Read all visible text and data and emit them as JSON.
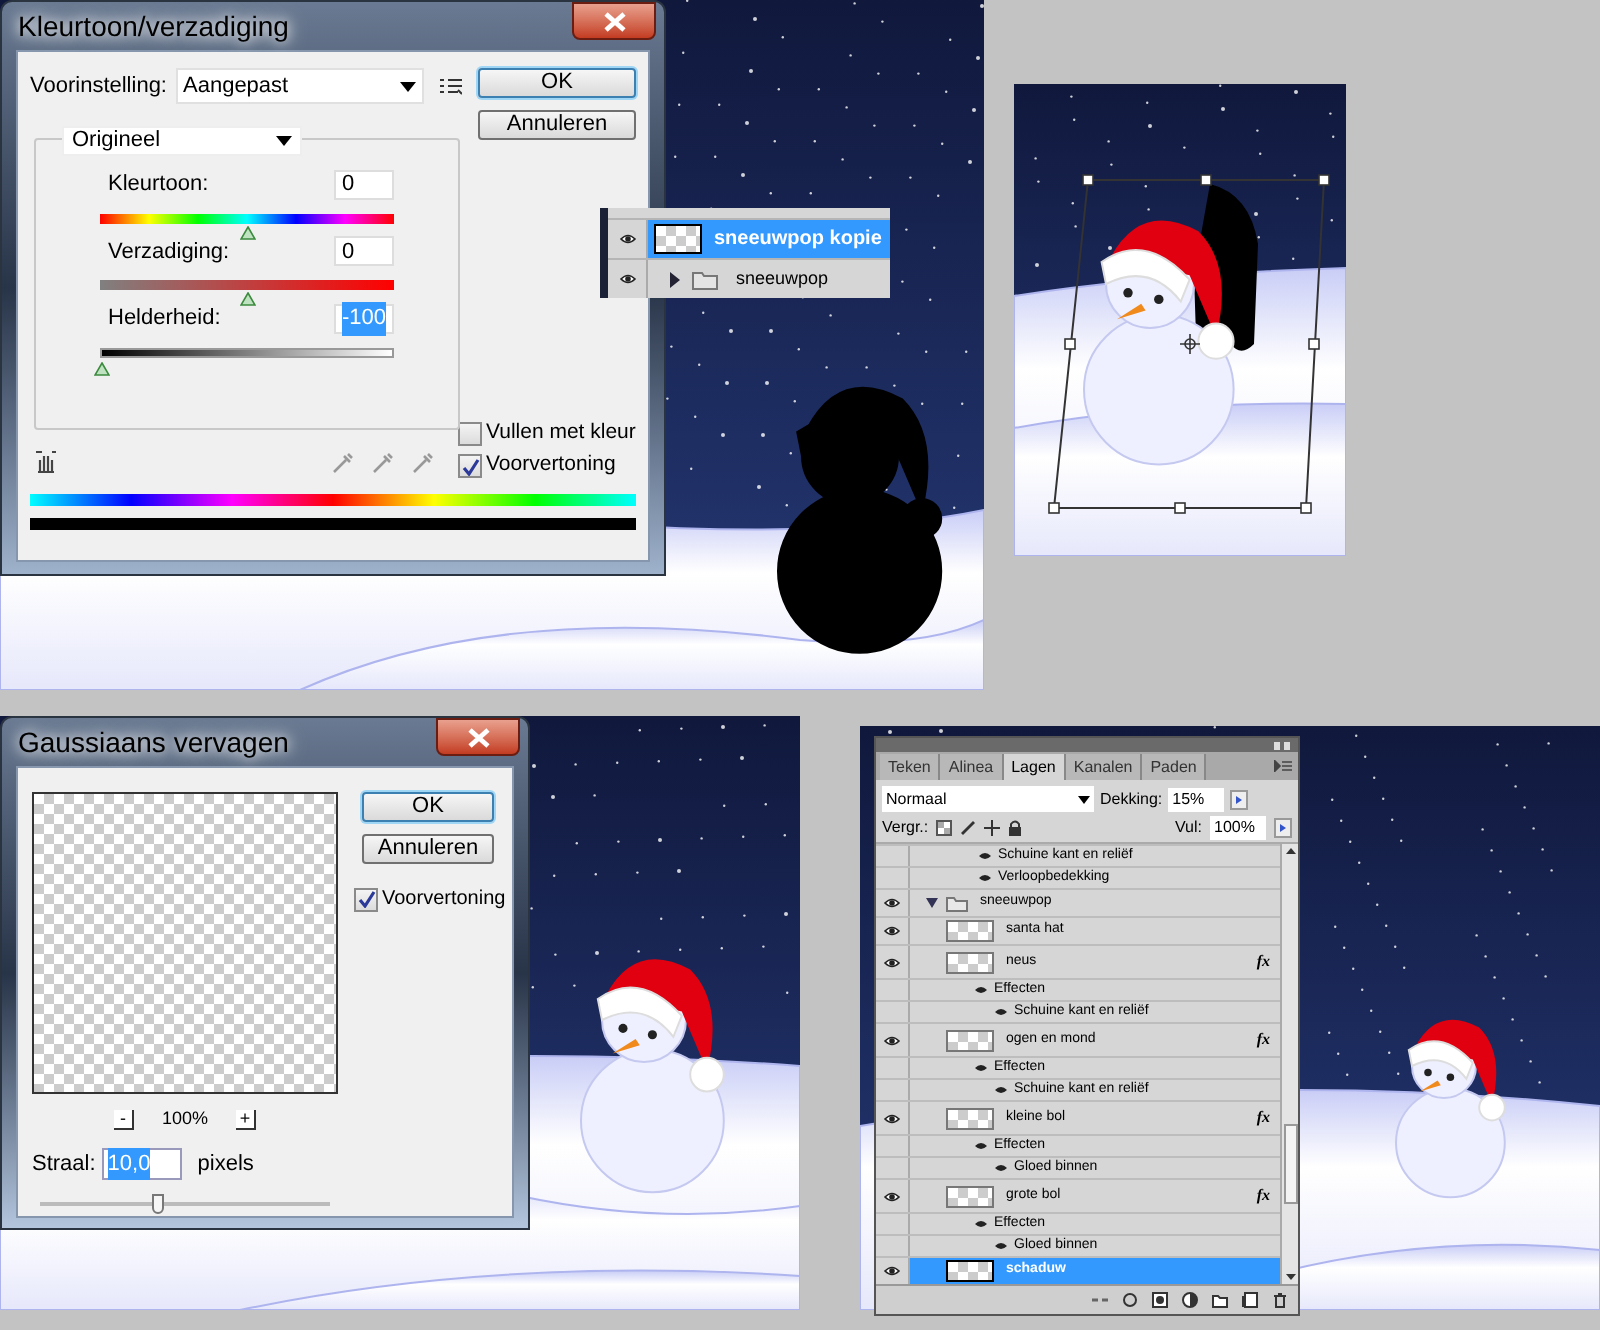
{
  "hue_saturation_dialog": {
    "title": "Kleurtoon/verzadiging",
    "preset_label": "Voorinstelling:",
    "preset_value": "Aangepast",
    "ok": "OK",
    "cancel": "Annuleren",
    "channel": "Origineel",
    "sliders": [
      {
        "kind": "hue",
        "label": "Kleurtoon:",
        "value": "0",
        "level": 0.5,
        "selected": false
      },
      {
        "kind": "saturation",
        "label": "Verzadiging:",
        "value": "0",
        "level": 0.5,
        "selected": false
      },
      {
        "kind": "lightness",
        "label": "Helderheid:",
        "value": "-100",
        "level": 0,
        "selected": true
      }
    ],
    "checkboxes": [
      {
        "label": "Vullen met kleur",
        "checked": false
      },
      {
        "label": "Voorvertoning",
        "checked": true
      }
    ]
  },
  "layer_snippet": {
    "rows": [
      {
        "kind": "layer",
        "name": "sneeuwpop kopie",
        "selected": true
      },
      {
        "kind": "group",
        "name": "sneeuwpop",
        "expanded": false,
        "selected": false
      }
    ]
  },
  "gaussian_blur_dialog": {
    "title": "Gaussiaans vervagen",
    "ok": "OK",
    "cancel": "Annuleren",
    "preview": {
      "label": "Voorvertoning",
      "checked": true
    },
    "zoom_out": "-",
    "zoom": "100%",
    "zoom_in": "+",
    "radius_label": "Straal:",
    "radius_value": "10,0",
    "radius_unit": "pixels",
    "level": 0.41
  },
  "layers_panel": {
    "tabs": [
      {
        "label": "Teken",
        "selected": false
      },
      {
        "label": "Alinea",
        "selected": false
      },
      {
        "label": "Lagen",
        "selected": true
      },
      {
        "label": "Kanalen",
        "selected": false
      },
      {
        "label": "Paden",
        "selected": false
      }
    ],
    "blend_mode": "Normaal",
    "opacity_label": "Dekking:",
    "opacity": "15%",
    "lock_label": "Vergr.:",
    "fill_label": "Vul:",
    "fill": "100%",
    "layers": [
      {
        "kind": "effect",
        "name": "Schuine kant en reliëf"
      },
      {
        "kind": "effect",
        "name": "Verloopbedekking"
      },
      {
        "kind": "group",
        "name": "sneeuwpop",
        "expanded": true,
        "selected": false,
        "children": [
          {
            "kind": "layer",
            "name": "santa hat",
            "selected": false
          },
          {
            "kind": "layer",
            "name": "neus",
            "selected": false,
            "fx_label": "fx",
            "children": [
              {
                "kind": "effects",
                "name": "Effecten",
                "children": [
                  {
                    "kind": "effect",
                    "name": "Schuine kant en reliëf"
                  }
                ]
              }
            ]
          },
          {
            "kind": "layer",
            "name": "ogen en mond",
            "selected": false,
            "fx_label": "fx",
            "children": [
              {
                "kind": "effects",
                "name": "Effecten",
                "children": [
                  {
                    "kind": "effect",
                    "name": "Schuine kant en reliëf"
                  }
                ]
              }
            ]
          },
          {
            "kind": "layer",
            "name": "kleine bol",
            "selected": false,
            "fx_label": "fx",
            "children": [
              {
                "kind": "effects",
                "name": "Effecten",
                "children": [
                  {
                    "kind": "effect",
                    "name": "Gloed binnen"
                  }
                ]
              }
            ]
          },
          {
            "kind": "layer",
            "name": "grote bol",
            "selected": false,
            "fx_label": "fx",
            "children": [
              {
                "kind": "effects",
                "name": "Effecten",
                "children": [
                  {
                    "kind": "effect",
                    "name": "Gloed binnen"
                  }
                ]
              }
            ]
          },
          {
            "kind": "layer",
            "name": "schaduw",
            "selected": true
          }
        ]
      }
    ]
  }
}
